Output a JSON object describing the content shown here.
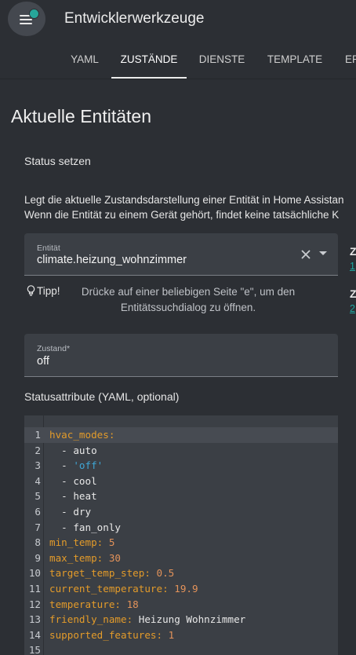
{
  "header": {
    "title": "Entwicklerwerkzeuge",
    "menu_icon": "menu-icon",
    "notification_dot_color": "#26a69a"
  },
  "tabs": [
    {
      "label": "YAML",
      "active": false
    },
    {
      "label": "ZUSTÄNDE",
      "active": true
    },
    {
      "label": "DIENSTE",
      "active": false
    },
    {
      "label": "TEMPLATE",
      "active": false
    },
    {
      "label": "ER",
      "active": false
    }
  ],
  "page": {
    "title": "Aktuelle Entitäten",
    "set_state": {
      "heading": "Status setzen",
      "description_lines": [
        "Legt die aktuelle Zustandsdarstellung einer Entität in Home Assistan",
        "Wenn die Entität zu einem Gerät gehört, findet keine tatsächliche K"
      ]
    },
    "entity_field": {
      "label": "Entität",
      "value": "climate.heizung_wohnzimmer",
      "clear_icon": "close-icon",
      "dropdown_icon": "chevron-down-icon"
    },
    "tip": {
      "label": "Tipp!",
      "icon": "lightbulb-icon",
      "text": "Drücke auf einer beliebigen Seite \"e\", um den Entitätssuchdialog zu öffnen."
    },
    "state_field": {
      "label": "Zustand*",
      "value": "off"
    },
    "attributes": {
      "label": "Statusattribute (YAML, optional)",
      "lines": [
        {
          "num": "1",
          "key": "hvac_modes",
          "sep": ":",
          "value": "",
          "vtype": "v"
        },
        {
          "num": "2",
          "key": "",
          "sep": "  - ",
          "value": "auto",
          "vtype": "v"
        },
        {
          "num": "3",
          "key": "",
          "sep": "  - ",
          "value": "'off'",
          "vtype": "s"
        },
        {
          "num": "4",
          "key": "",
          "sep": "  - ",
          "value": "cool",
          "vtype": "v"
        },
        {
          "num": "5",
          "key": "",
          "sep": "  - ",
          "value": "heat",
          "vtype": "v"
        },
        {
          "num": "6",
          "key": "",
          "sep": "  - ",
          "value": "dry",
          "vtype": "v"
        },
        {
          "num": "7",
          "key": "",
          "sep": "  - ",
          "value": "fan_only",
          "vtype": "v"
        },
        {
          "num": "8",
          "key": "min_temp",
          "sep": ": ",
          "value": "5",
          "vtype": "n"
        },
        {
          "num": "9",
          "key": "max_temp",
          "sep": ": ",
          "value": "30",
          "vtype": "n"
        },
        {
          "num": "10",
          "key": "target_temp_step",
          "sep": ": ",
          "value": "0.5",
          "vtype": "n"
        },
        {
          "num": "11",
          "key": "current_temperature",
          "sep": ": ",
          "value": "19.9",
          "vtype": "n"
        },
        {
          "num": "12",
          "key": "temperature",
          "sep": ": ",
          "value": "18",
          "vtype": "n"
        },
        {
          "num": "13",
          "key": "friendly_name",
          "sep": ": ",
          "value": "Heizung Wohnzimmer",
          "vtype": "v"
        },
        {
          "num": "14",
          "key": "supported_features",
          "sep": ": ",
          "value": "1",
          "vtype": "n"
        },
        {
          "num": "15",
          "key": "",
          "sep": "",
          "value": "",
          "vtype": "v"
        }
      ]
    }
  },
  "side_panel": [
    {
      "heading": "Z",
      "link": "1"
    },
    {
      "heading": "Z",
      "link": "2"
    }
  ],
  "colors": {
    "background": "#2c2f34",
    "card": "#3b3f45",
    "accent": "#1fa6a0",
    "yaml_key": "#e39b2a",
    "yaml_number": "#e2925a",
    "yaml_string": "#3fa7d6"
  }
}
